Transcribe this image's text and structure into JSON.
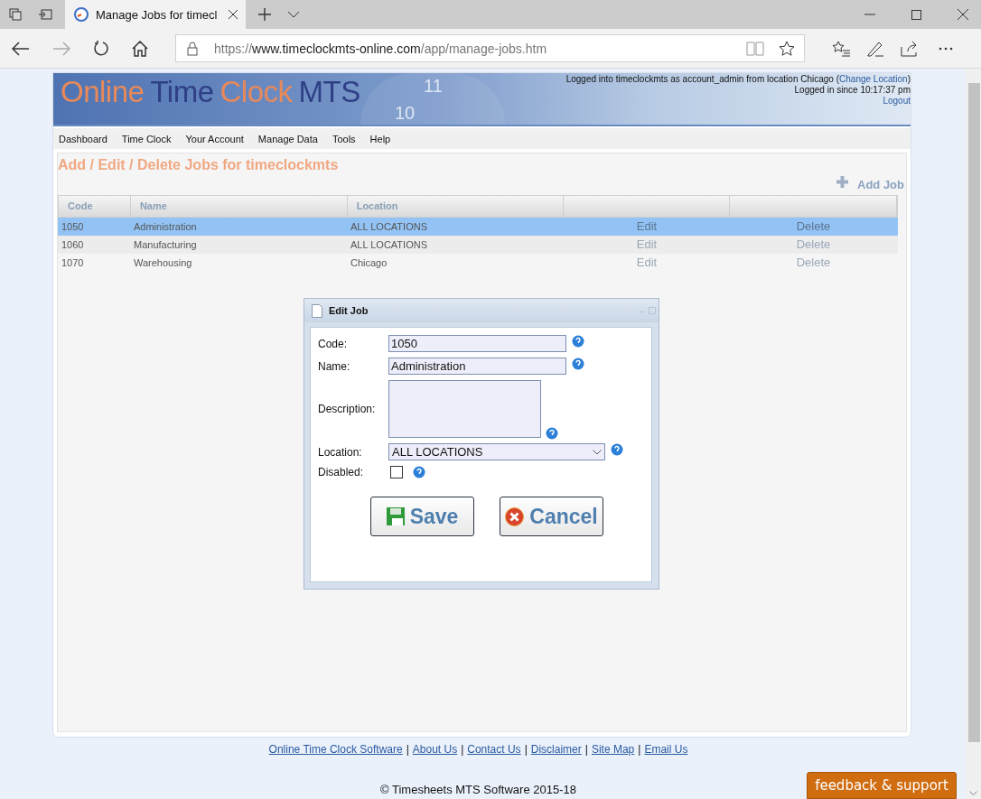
{
  "browser": {
    "tab_title": "Manage Jobs for timecl",
    "url_prefix": "https://",
    "url_host": "www.timeclockmts-online.com",
    "url_path": "/app/manage-jobs.htm"
  },
  "header": {
    "logo_parts": [
      {
        "text": "Online",
        "kind": "accent"
      },
      {
        "text": "Time",
        "kind": "dark"
      },
      {
        "text": "Clock",
        "kind": "accent"
      },
      {
        "text": "MTS",
        "kind": "dark"
      }
    ],
    "clock_digits": [
      "11",
      "10"
    ],
    "login_text": "Logged into timeclockmts as account_admin from location Chicago (",
    "change_location": "Change Location",
    "login_close": ")",
    "since": "Logged in since 10:17:37 pm",
    "logout": "Logout"
  },
  "menu": [
    "Dashboard",
    "Time Clock",
    "Your Account",
    "Manage Data",
    "Tools",
    "Help"
  ],
  "page_title": "Add / Edit / Delete Jobs for timeclockmts",
  "add_job": "Add Job",
  "table": {
    "columns": [
      "Code",
      "Name",
      "Location"
    ],
    "rows": [
      {
        "code": "1050",
        "name": "Administration",
        "location": "ALL LOCATIONS",
        "edit": "Edit",
        "delete": "Delete",
        "selected": true
      },
      {
        "code": "1060",
        "name": "Manufacturing",
        "location": "ALL LOCATIONS",
        "edit": "Edit",
        "delete": "Delete",
        "selected": false
      },
      {
        "code": "1070",
        "name": "Warehousing",
        "location": "Chicago",
        "edit": "Edit",
        "delete": "Delete",
        "selected": false
      }
    ]
  },
  "dialog": {
    "title": "Edit Job",
    "code_label": "Code:",
    "code": "1050",
    "name_label": "Name:",
    "name": "Administration",
    "description_label": "Description:",
    "location_label": "Location:",
    "location": "ALL LOCATIONS",
    "disabled_label": "Disabled:",
    "disabled": false,
    "save": "Save",
    "cancel": "Cancel"
  },
  "footer": {
    "links": [
      "Online Time Clock Software",
      "About Us",
      "Contact Us",
      "Disclaimer",
      "Site Map",
      "Email Us"
    ],
    "separator": "|",
    "copyright": "© Timesheets MTS Software 2015-18"
  },
  "feedback": "feedback & support"
}
